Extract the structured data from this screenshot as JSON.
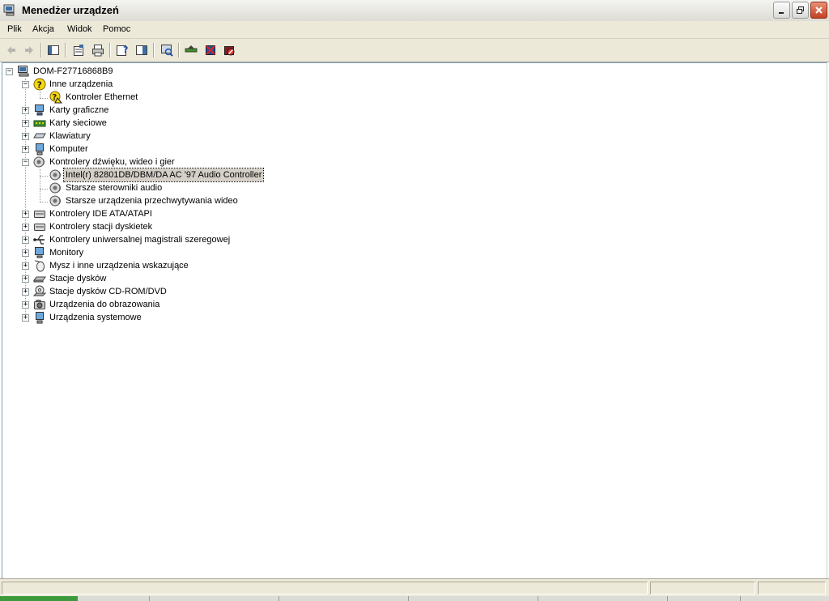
{
  "window": {
    "title": "Menedżer urządzeń",
    "controls": [
      "minimize",
      "restore",
      "close"
    ]
  },
  "menu": {
    "items": [
      "Plik",
      "Akcja",
      "Widok",
      "Pomoc"
    ]
  },
  "toolbar": {
    "buttons": [
      "back-icon",
      "forward-icon",
      "show-hide-tree-icon",
      "properties-icon",
      "print-icon",
      "help-icon",
      "show-hide-action-pane-icon",
      "scan-hardware-icon",
      "update-driver-icon",
      "uninstall-icon",
      "disable-icon"
    ]
  },
  "tree": {
    "root": "DOM-F27716868B9",
    "categories": [
      {
        "label": "Inne urządzenia",
        "expanded": true,
        "children": [
          "Kontroler Ethernet"
        ]
      },
      {
        "label": "Karty graficzne",
        "expanded": false
      },
      {
        "label": "Karty sieciowe",
        "expanded": false
      },
      {
        "label": "Klawiatury",
        "expanded": false
      },
      {
        "label": "Komputer",
        "expanded": false
      },
      {
        "label": "Kontrolery dźwięku, wideo i gier",
        "expanded": true,
        "children": [
          "Intel(r) 82801DB/DBM/DA AC '97 Audio Controller",
          "Starsze sterowniki audio",
          "Starsze urządzenia przechwytywania wideo"
        ]
      },
      {
        "label": "Kontrolery IDE ATA/ATAPI",
        "expanded": false
      },
      {
        "label": "Kontrolery stacji dyskietek",
        "expanded": false
      },
      {
        "label": "Kontrolery uniwersalnej magistrali szeregowej",
        "expanded": false
      },
      {
        "label": "Monitory",
        "expanded": false
      },
      {
        "label": "Mysz i inne urządzenia wskazujące",
        "expanded": false
      },
      {
        "label": "Stacje dysków",
        "expanded": false
      },
      {
        "label": "Stacje dysków CD-ROM/DVD",
        "expanded": false
      },
      {
        "label": "Urządzenia do obrazowania",
        "expanded": false
      },
      {
        "label": "Urządzenia systemowe",
        "expanded": false
      }
    ],
    "selected": "Intel(r) 82801DB/DBM/DA AC '97 Audio Controller"
  },
  "colors": {
    "selection_bg": "#d4d0c8",
    "chrome_bg": "#ece9d8",
    "close_button": "#c24124"
  }
}
